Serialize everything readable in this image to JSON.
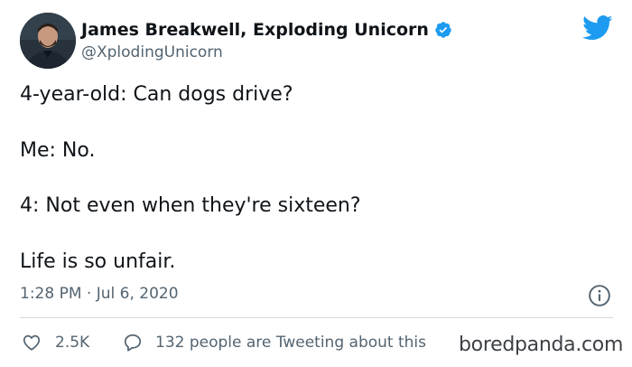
{
  "author": {
    "display_name": "James Breakwell, Exploding Unicorn",
    "handle": "@XplodingUnicorn",
    "verified": true,
    "avatar_icon": "avatar-photo"
  },
  "brand": {
    "icon": "twitter-bird-icon",
    "color": "#1d9bf0"
  },
  "tweet": {
    "lines": [
      "4-year-old: Can dogs drive?",
      "Me: No.",
      "4: Not even when they're sixteen?",
      "Life is so unfair."
    ],
    "timestamp": "1:28 PM · Jul 6, 2020"
  },
  "actions": {
    "likes_label": "2.5K",
    "likes_icon": "heart-icon",
    "conversation_label": "132 people are Tweeting about this",
    "conversation_icon": "speech-bubble-icon",
    "info_icon": "info-icon"
  },
  "watermark": "boredpanda.com",
  "colors": {
    "text": "#0f1419",
    "secondary": "#536471",
    "divider": "#cfd9de",
    "verified": "#1d9bf0"
  }
}
